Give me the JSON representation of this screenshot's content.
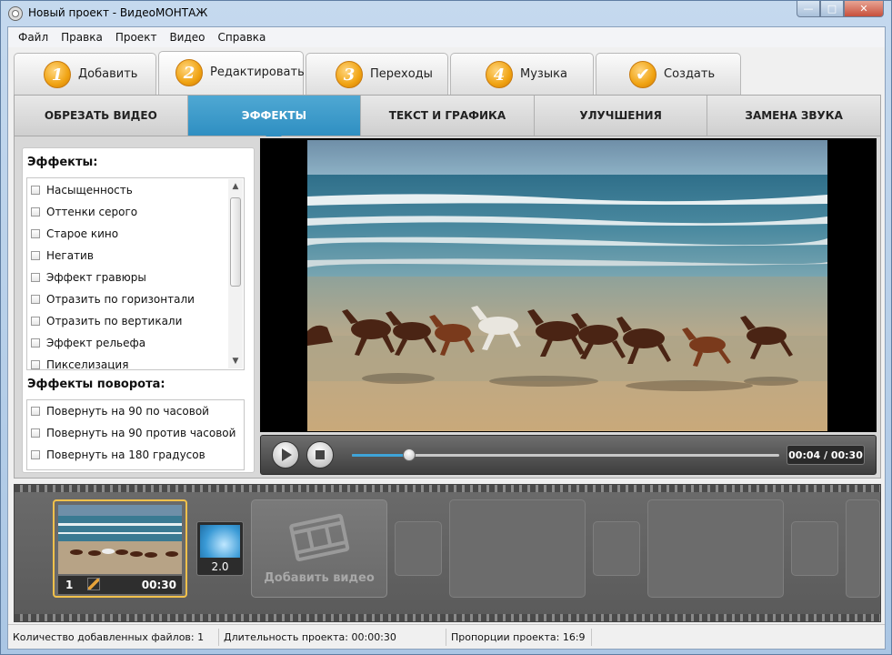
{
  "window": {
    "title": "Новый проект - ВидеоМОНТАЖ",
    "minimize": "—",
    "maximize": "□",
    "close": "✕"
  },
  "menu": [
    "Файл",
    "Правка",
    "Проект",
    "Видео",
    "Справка"
  ],
  "steps": [
    {
      "num": "1",
      "label": "Добавить",
      "active": false
    },
    {
      "num": "2",
      "label": "Редактировать",
      "active": true
    },
    {
      "num": "3",
      "label": "Переходы",
      "active": false
    },
    {
      "num": "4",
      "label": "Музыка",
      "active": false
    },
    {
      "num": "✔",
      "label": "Создать",
      "active": false
    }
  ],
  "subtabs": [
    {
      "label": "ОБРЕЗАТЬ ВИДЕО",
      "active": false
    },
    {
      "label": "ЭФФЕКТЫ",
      "active": true
    },
    {
      "label": "ТЕКСТ И ГРАФИКА",
      "active": false
    },
    {
      "label": "УЛУЧШЕНИЯ",
      "active": false
    },
    {
      "label": "ЗАМЕНА ЗВУКА",
      "active": false
    }
  ],
  "effects": {
    "title": "Эффекты:",
    "items": [
      "Насыщенность",
      "Оттенки серого",
      "Старое кино",
      "Негатив",
      "Эффект гравюры",
      "Отразить по горизонтали",
      "Отразить по вертикали",
      "Эффект рельефа",
      "Пикселизация"
    ],
    "scroll_up": "▲",
    "scroll_down": "▼"
  },
  "rotation": {
    "title": "Эффекты поворота:",
    "items": [
      "Повернуть на 90 по часовой",
      "Повернуть на 90 против часовой",
      "Повернуть на 180 градусов"
    ]
  },
  "player": {
    "time": "00:04 / 00:30",
    "progress": 0.135
  },
  "timeline": {
    "clip": {
      "number": "1",
      "duration": "00:30"
    },
    "transition": {
      "value": "2.0"
    },
    "add_video_label": "Добавить видео"
  },
  "status": {
    "files": "Количество добавленных файлов: 1",
    "duration": "Длительность проекта:  00:00:30",
    "aspect": "Пропорции проекта:  16:9"
  }
}
